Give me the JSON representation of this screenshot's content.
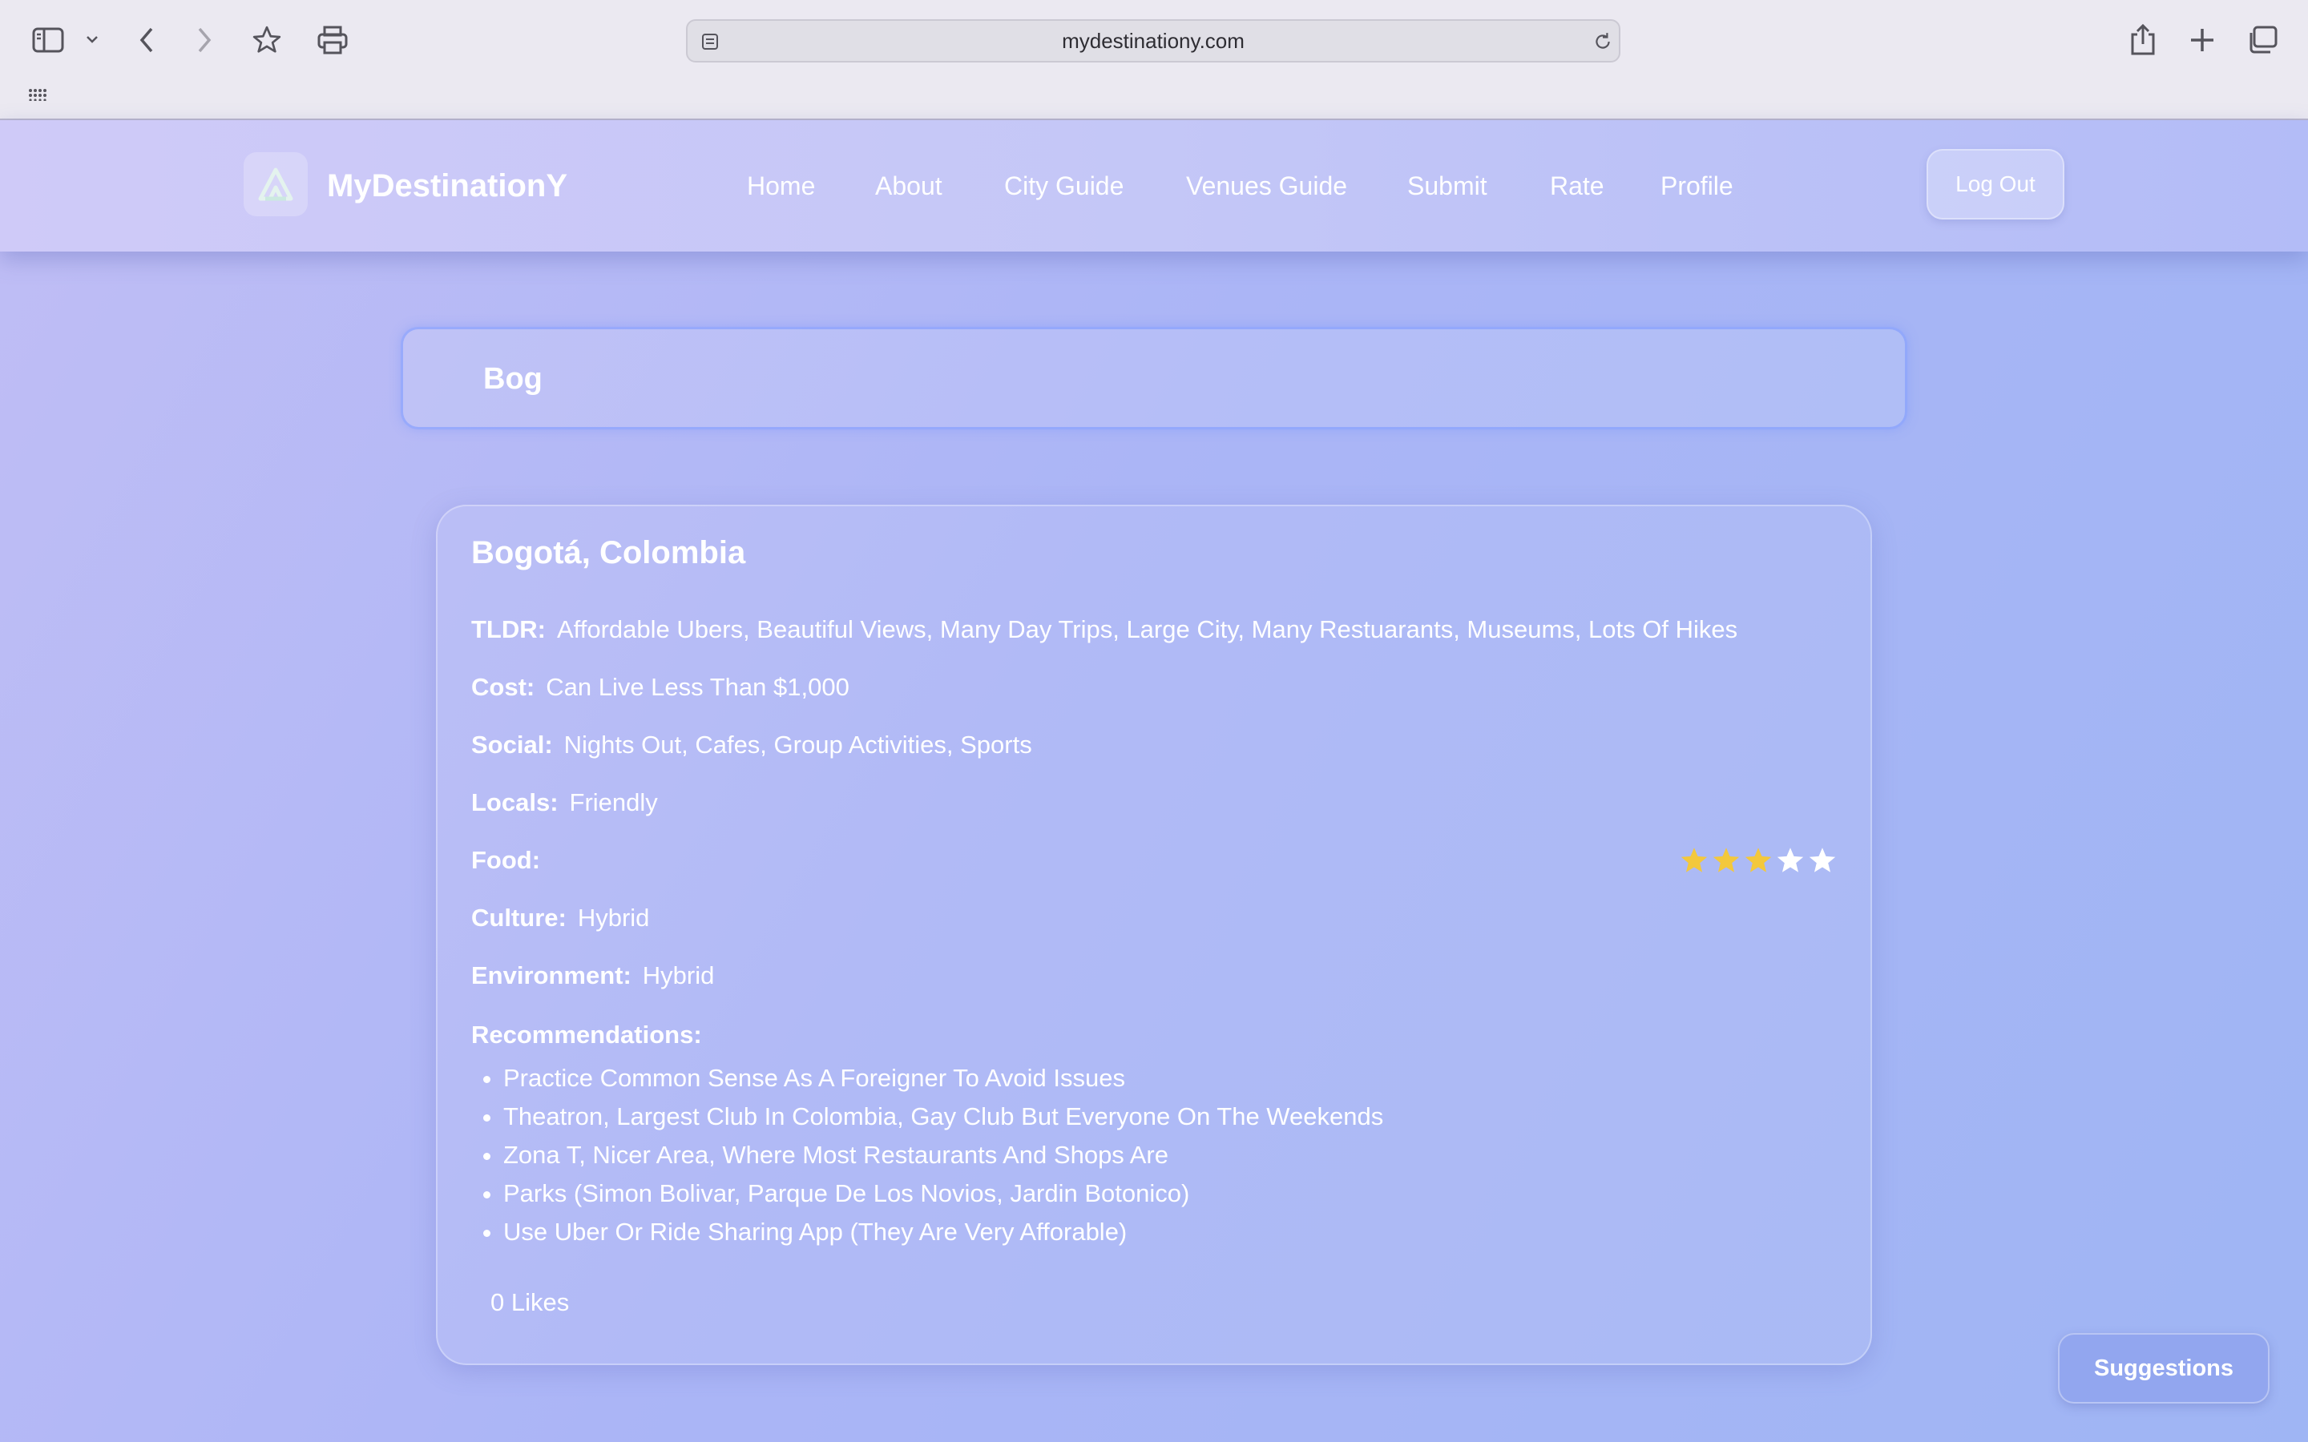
{
  "browser": {
    "url": "mydestinationy.com",
    "icons": [
      "sidebar-icon",
      "chevron-down-icon",
      "back-arrow-icon",
      "forward-arrow-icon",
      "star-icon",
      "print-icon",
      "page-icon",
      "reload-icon",
      "share-icon",
      "plus-icon",
      "tabs-icon",
      "grid-icon"
    ]
  },
  "nav": {
    "brand": "MyDestinationY",
    "links": [
      "Home",
      "About",
      "City Guide",
      "Venues Guide",
      "Submit",
      "Rate",
      "Profile"
    ],
    "logout": "Log Out"
  },
  "search": {
    "value": "Bog"
  },
  "city": {
    "title": "Bogotá, Colombia",
    "tldr_label": "TLDR:",
    "tldr": "Affordable Ubers, Beautiful Views, Many Day Trips, Large City, Many Restuarants, Museums, Lots Of Hikes",
    "cost_label": "Cost:",
    "cost": "Can Live Less Than $1,000",
    "social_label": "Social:",
    "social": "Nights Out, Cafes, Group Activities, Sports",
    "locals_label": "Locals:",
    "locals": "Friendly",
    "food_label": "Food:",
    "food_rating": 3,
    "food_rating_max": 5,
    "culture_label": "Culture:",
    "culture": "Hybrid",
    "environment_label": "Environment:",
    "environment": "Hybrid",
    "recommendations_label": "Recommendations:",
    "recommendations": [
      "Practice Common Sense As A Foreigner To Avoid Issues",
      "Theatron, Largest Club In Colombia, Gay Club But Everyone On The Weekends",
      "Zona T, Nicer Area, Where Most Restaurants And Shops Are",
      "Parks (Simon Bolivar, Parque De Los Novios, Jardin Botonico)",
      "Use Uber Or Ride Sharing App (They Are Very Afforable)"
    ],
    "likes": "0 Likes"
  },
  "suggestions_label": "Suggestions",
  "colors": {
    "star_filled": "#f3c83c",
    "star_empty": "#ffffff",
    "accent": "#92a6ef"
  }
}
